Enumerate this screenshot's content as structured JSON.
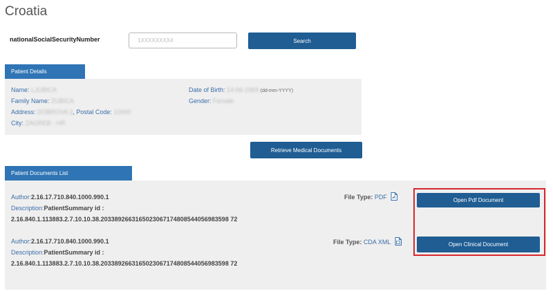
{
  "page": {
    "title": "Croatia"
  },
  "search": {
    "field_label": "nationalSocialSecurityNumber",
    "input_value": "1XXXXXXXX4",
    "button_label": "Search"
  },
  "patient_details": {
    "tab_label": "Patient Details",
    "name_label": "Name:",
    "name_value": "LJUBICA",
    "family_name_label": "Family Name:",
    "family_name_value": "ZUBICA",
    "address_label": "Address:",
    "address_value": "DOBROVA 2",
    "postal_code_label": ", Postal Code:",
    "postal_code_value": "10000",
    "city_label": "City:",
    "city_value": "ZAGREB - HR",
    "dob_label": "Date of Birth:",
    "dob_value": "14-06-1969",
    "dob_format": "(dd-mm-YYYY)",
    "gender_label": "Gender:",
    "gender_value": "Female"
  },
  "retrieve": {
    "button_label": "Retrieve Medical Documents"
  },
  "documents": {
    "tab_label": "Patient Documents List",
    "items": [
      {
        "author_label": "Author:",
        "author_value": "2.16.17.710.840.1000.990.1",
        "description_label": "Description:",
        "description_value": "PatientSummary id :",
        "description_id": "2.16.840.1.113883.2.7.10.10.38.2033892663165023067174808544056983598 72",
        "file_type_label": "File Type:",
        "file_type_value": "PDF",
        "icon": "pdf-file-icon",
        "button_label": "Open Pdf Document"
      },
      {
        "author_label": "Author:",
        "author_value": "2.16.17.710.840.1000.990.1",
        "description_label": "Description:",
        "description_value": "PatientSummary id :",
        "description_id": "2.16.840.1.113883.2.7.10.10.38.2033892663165023067174808544056983598 72",
        "file_type_label": "File Type:",
        "file_type_value": "CDA XML",
        "icon": "xml-file-icon",
        "button_label": "Open Clinical Document"
      }
    ]
  },
  "colors": {
    "primary_button": "#1f5d93",
    "section_tab": "#2f74b5",
    "panel_bg": "#efefef",
    "label_blue": "#3b6ea8",
    "highlight": "#d6262b"
  }
}
